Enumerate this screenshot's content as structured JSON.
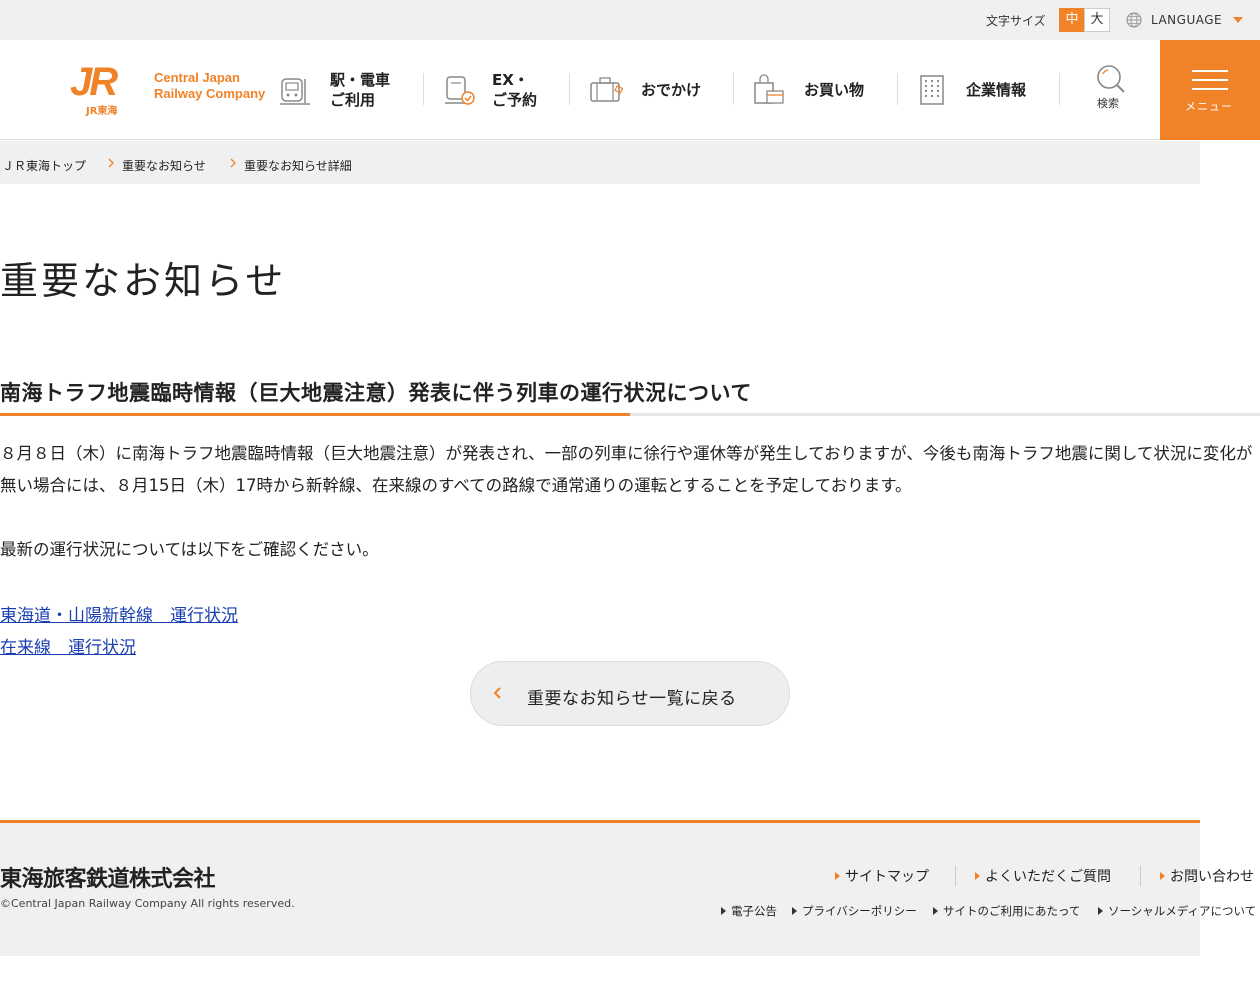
{
  "topbar": {
    "font_size_label": "文字サイズ",
    "font_size_medium": "中",
    "font_size_large": "大",
    "language_label": "LANGUAGE"
  },
  "header": {
    "logo_mark": "JR",
    "logo_sub": "JR東海",
    "logo_en_line1": "Central Japan",
    "logo_en_line2": "Railway Company",
    "nav": [
      {
        "line1": "駅・電車",
        "line2": "ご利用",
        "icon": "train-icon"
      },
      {
        "line1": "EX・",
        "line2": "ご予約",
        "icon": "reservation-icon"
      },
      {
        "line1": "おでかけ",
        "line2": "",
        "icon": "suitcase-icon"
      },
      {
        "line1": "お買い物",
        "line2": "",
        "icon": "shopping-bag-icon"
      },
      {
        "line1": "企業情報",
        "line2": "",
        "icon": "building-icon"
      }
    ],
    "search_label": "検索",
    "menu_label": "メニュー"
  },
  "breadcrumb": [
    "ＪＲ東海トップ",
    "重要なお知らせ",
    "重要なお知らせ詳細"
  ],
  "main": {
    "page_title": "重要なお知らせ",
    "article_title": "南海トラフ地震臨時情報（巨大地震注意）発表に伴う列車の運行状況について",
    "paragraph1": "８月８日（木）に南海トラフ地震臨時情報（巨大地震注意）が発表され、一部の列車に徐行や運休等が発生しておりますが、今後も南海トラフ地震に関して状況に変化が無い場合には、８月15日（木）17時から新幹線、在来線のすべての路線で通常通りの運転とすることを予定しております。",
    "paragraph2": "最新の運行状況については以下をご確認ください。",
    "link1": "東海道・山陽新幹線　運行状況",
    "link2": "在来線　運行状況",
    "back_button": "重要なお知らせ一覧に戻る"
  },
  "footer": {
    "company": "東海旅客鉄道株式会社",
    "copyright": "©Central Japan Railway Company All rights reserved.",
    "links": [
      "サイトマップ",
      "よくいただくご質問",
      "お問い合わせ"
    ],
    "sub_links": [
      "電子公告",
      "プライバシーポリシー",
      "サイトのご利用にあたって",
      "ソーシャルメディアについて"
    ]
  },
  "colors": {
    "brand_orange": "#f08228",
    "link_blue": "#1a3fb0",
    "background_gray": "#f0f0f0"
  }
}
